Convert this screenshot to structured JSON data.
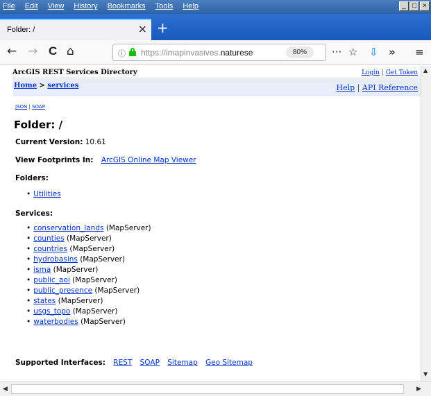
{
  "browser": {
    "menu": [
      "File",
      "Edit",
      "View",
      "History",
      "Bookmarks",
      "Tools",
      "Help"
    ],
    "tab_title": "Folder: /",
    "url_text_prefix": "https://imapinvasives.",
    "url_text_domain": "naturese",
    "zoom": "80%"
  },
  "page": {
    "directory_title": "ArcGIS REST Services Directory",
    "login": "Login",
    "get_token": "Get Token",
    "separator": "|",
    "breadcrumb_home": "Home",
    "breadcrumb_sep": ">",
    "breadcrumb_services": "services",
    "help": "Help",
    "api_reference": "API Reference",
    "json": "JSON",
    "soap": "SOAP",
    "folder_title": "Folder: /",
    "current_version_label": "Current Version:",
    "current_version_value": "10.61",
    "view_footprints_label": "View Footprints In:",
    "view_footprints_link": "ArcGIS Online Map Viewer",
    "folders_heading": "Folders:",
    "folders": [
      "Utilities"
    ],
    "services_heading": "Services:",
    "services": [
      {
        "name": "conservation_lands",
        "type": "(MapServer)"
      },
      {
        "name": "counties",
        "type": "(MapServer)"
      },
      {
        "name": "countries",
        "type": "(MapServer)"
      },
      {
        "name": "hydrobasins",
        "type": "(MapServer)"
      },
      {
        "name": "isma",
        "type": "(MapServer)"
      },
      {
        "name": "public_aoi",
        "type": "(MapServer)"
      },
      {
        "name": "public_presence",
        "type": "(MapServer)"
      },
      {
        "name": "states",
        "type": "(MapServer)"
      },
      {
        "name": "usgs_topo",
        "type": "(MapServer)"
      },
      {
        "name": "waterbodies",
        "type": "(MapServer)"
      }
    ],
    "supported_interfaces_label": "Supported Interfaces:",
    "interfaces": [
      "REST",
      "SOAP",
      "Sitemap",
      "Geo Sitemap"
    ]
  }
}
